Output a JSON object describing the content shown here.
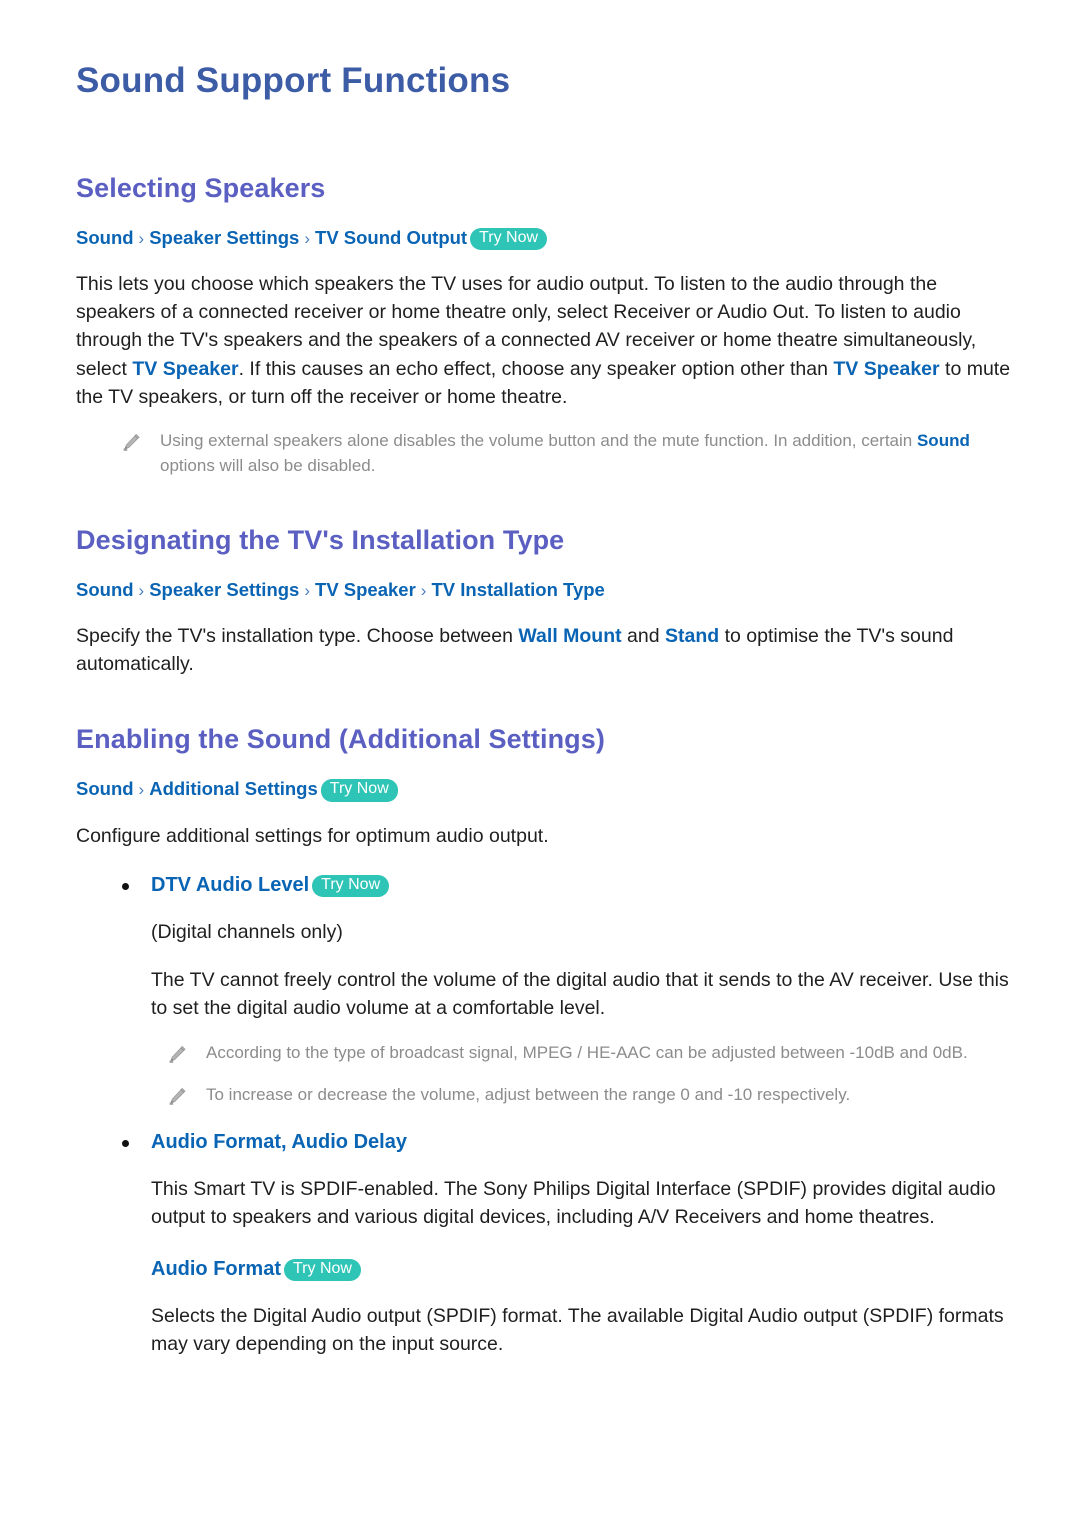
{
  "document": {
    "title": "Sound Support Functions"
  },
  "sections": [
    {
      "id": "selecting-speakers",
      "title": "Selecting Speakers",
      "breadcrumb": {
        "crumbs": [
          "Sound",
          "Speaker Settings",
          "TV Sound Output"
        ],
        "separator": "›",
        "badge": "Try Now"
      },
      "paragraph": {
        "part1": "This lets you choose which speakers the TV uses for audio output. To listen to the audio through the speakers of a connected receiver or home theatre only, select Receiver or Audio Out. To listen to audio through the TV's speakers and the speakers of a connected AV receiver or home theatre simultaneously, select ",
        "hl1": "TV Speaker",
        "part2": ". If this causes an echo effect, choose any speaker option other than ",
        "hl2": "TV Speaker",
        "part3": " to mute the TV speakers, or turn off the receiver or home theatre."
      },
      "note": {
        "icon": "pencil-icon",
        "part1": "Using external speakers alone disables the volume button and the mute function. In addition, certain ",
        "hl1": "Sound",
        "part2": " options will also be disabled."
      }
    },
    {
      "id": "installation-type",
      "title": "Designating the TV's Installation Type",
      "breadcrumb": {
        "crumbs": [
          "Sound",
          "Speaker Settings",
          "TV Speaker",
          "TV Installation Type"
        ],
        "separator": "›",
        "badge": null
      },
      "paragraph": {
        "part1": "Specify the TV's installation type. Choose between ",
        "hl1": "Wall Mount",
        "part2": " and ",
        "hl2": "Stand",
        "part3": " to optimise the TV's sound automatically."
      }
    },
    {
      "id": "additional-settings",
      "title": "Enabling the Sound (Additional Settings)",
      "breadcrumb": {
        "crumbs": [
          "Sound",
          "Additional Settings"
        ],
        "separator": "›",
        "badge": "Try Now"
      },
      "intro": "Configure additional settings for optimum audio output.",
      "bullets": [
        {
          "label": "DTV Audio Level",
          "badge": "Try Now",
          "subtitle": "(Digital channels only)",
          "paragraph": "The TV cannot freely control the volume of the digital audio that it sends to the AV receiver. Use this to set the digital audio volume at a comfortable level.",
          "notes": [
            "According to the type of broadcast signal, MPEG / HE-AAC can be adjusted between -10dB and 0dB.",
            "To increase or decrease the volume, adjust between the range 0 and -10 respectively."
          ]
        },
        {
          "label": "Audio Format, Audio Delay",
          "badge": null,
          "paragraph": "This Smart TV is SPDIF-enabled. The Sony Philips Digital Interface (SPDIF) provides digital audio output to speakers and various digital devices, including A/V Receivers and home theatres.",
          "sub": {
            "label": "Audio Format",
            "badge": "Try Now",
            "paragraph": "Selects the Digital Audio output (SPDIF) format. The available Digital Audio output (SPDIF) formats may vary depending on the input source."
          }
        }
      ]
    }
  ],
  "colors": {
    "doc_title": "#3d5ca6",
    "section_title": "#5b5fc2",
    "link_blue": "#0a64b4",
    "badge_bg": "#2ec4b6",
    "badge_text": "#ffffff",
    "body_text": "#1f1f1f",
    "note_text": "#8c8c8c"
  }
}
